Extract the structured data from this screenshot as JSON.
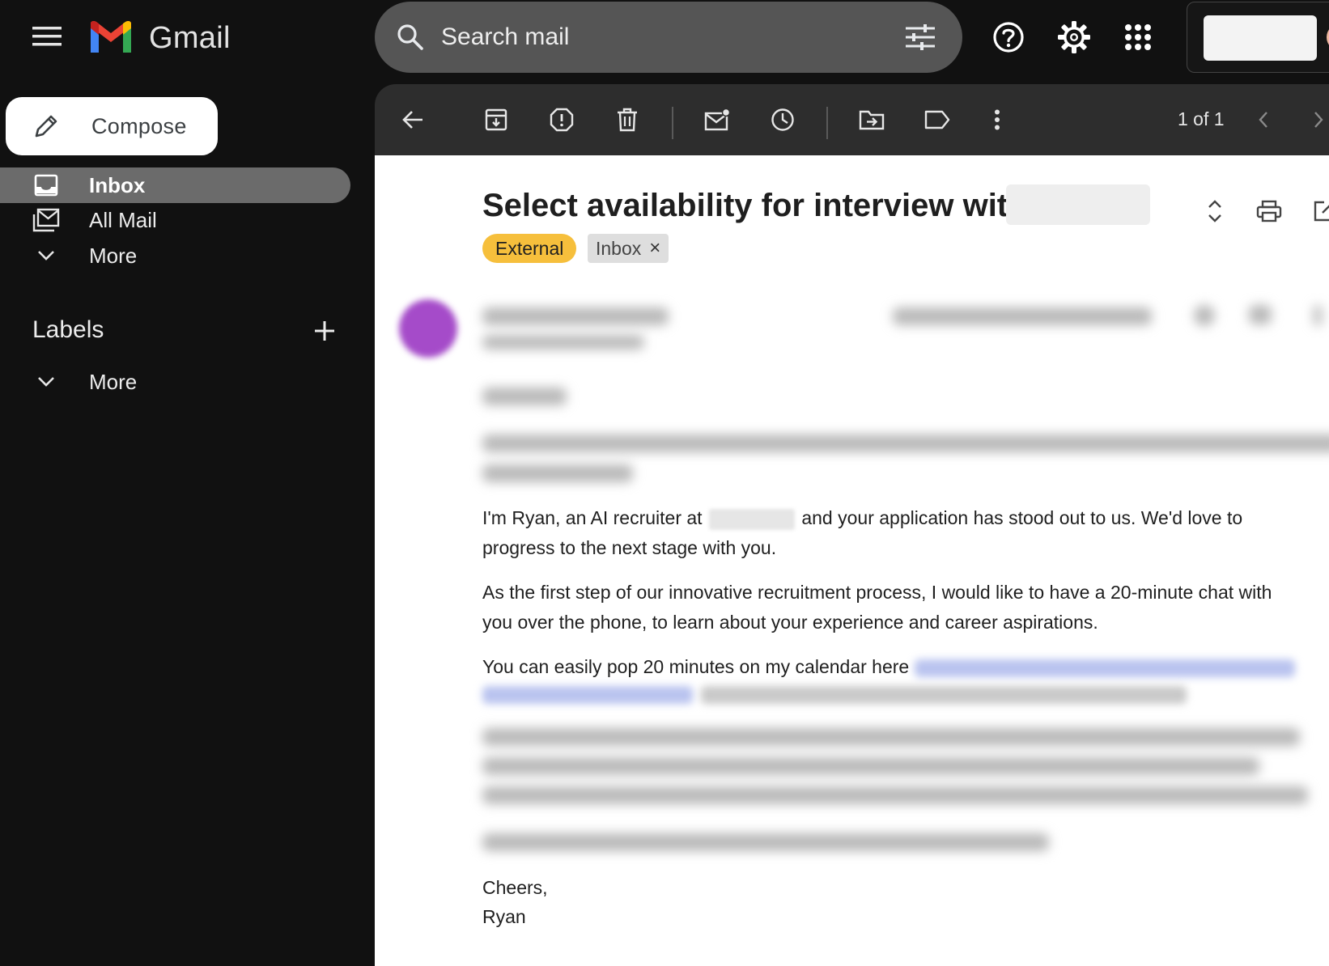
{
  "header": {
    "app_name": "Gmail",
    "search_placeholder": "Search mail"
  },
  "sidebar": {
    "compose_label": "Compose",
    "items": [
      {
        "label": "Inbox",
        "icon": "inbox-icon",
        "active": true
      },
      {
        "label": "All Mail",
        "icon": "all-mail-icon",
        "active": false
      },
      {
        "label": "More",
        "icon": "chevron-down-icon",
        "active": false
      }
    ],
    "labels_heading": "Labels",
    "labels_more": "More"
  },
  "toolbar": {
    "pager_text": "1 of 1"
  },
  "message": {
    "subject": "Select availability for interview with",
    "chips": {
      "external": "External",
      "inbox": "Inbox",
      "inbox_remove": "×"
    },
    "paragraphs": {
      "p1_start": "I'm Ryan, an AI recruiter at",
      "p1_end": "and your application has stood out to us. We'd love to progress to the next stage with you.",
      "p2": "As the first step of our innovative recruitment process, I would like to have a 20-minute chat with you over the phone, to learn about your experience and career aspirations.",
      "p3_start": "You can easily pop 20 minutes on my calendar here"
    },
    "signoff": "Cheers,",
    "signature": "Ryan"
  },
  "colors": {
    "sidebar_bg": "#111111",
    "search_bg": "#555555",
    "toolbar_bg": "#2d2d2d",
    "active_nav_bg": "#6b6b6b",
    "external_chip": "#f6bf3c",
    "avatar": "#a54bc9"
  }
}
